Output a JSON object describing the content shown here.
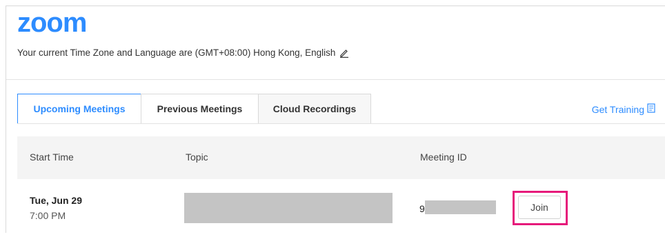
{
  "header": {
    "logo": "zoom",
    "timezone_text": "Your current Time Zone and Language are (GMT+08:00) Hong Kong, English"
  },
  "tabs": [
    {
      "label": "Upcoming Meetings",
      "active": true
    },
    {
      "label": "Previous Meetings",
      "active": false
    },
    {
      "label": "Cloud Recordings",
      "active": false
    }
  ],
  "training": {
    "label": "Get Training"
  },
  "table": {
    "columns": [
      "Start Time",
      "Topic",
      "Meeting ID"
    ],
    "rows": [
      {
        "date": "Tue, Jun 29",
        "time": "7:00 PM",
        "topic": "",
        "meeting_id_visible": "9",
        "join_label": "Join"
      }
    ]
  },
  "colors": {
    "brand": "#2d8cff",
    "highlight": "#e6197a",
    "redaction": "#c4c4c4"
  },
  "icons": {
    "edit": "pencil-icon",
    "training": "book-icon"
  }
}
